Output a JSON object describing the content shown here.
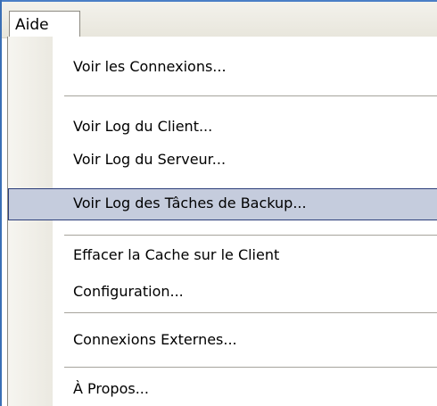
{
  "menubar": {
    "title": "Aide"
  },
  "menu": {
    "items": [
      {
        "label": "Voir les Connexions..."
      },
      {
        "label": "Voir Log du Client..."
      },
      {
        "label": "Voir Log du Serveur..."
      },
      {
        "label": "Voir Log des Tâches de Backup..."
      },
      {
        "label": "Effacer la Cache sur le Client"
      },
      {
        "label": "Configuration..."
      },
      {
        "label": "Connexions Externes..."
      },
      {
        "label": "À Propos..."
      }
    ],
    "selected_index": 3
  },
  "colors": {
    "highlight": "#c5ccdd",
    "highlight_border": "#2c3e7a",
    "separator": "#a6a49c"
  }
}
